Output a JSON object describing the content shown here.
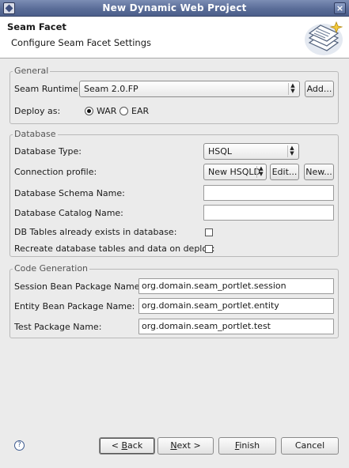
{
  "window": {
    "title": "New Dynamic Web Project"
  },
  "header": {
    "title": "Seam Facet",
    "description": "Configure Seam Facet Settings"
  },
  "general": {
    "label": "General",
    "runtime_label": "Seam Runtime:",
    "runtime_value": "Seam 2.0.FP",
    "add_label": "Add...",
    "deploy_label": "Deploy as:",
    "war_label": "WAR",
    "ear_label": "EAR",
    "deploy_selected": "WAR"
  },
  "database": {
    "label": "Database",
    "type_label": "Database Type:",
    "type_value": "HSQL",
    "profile_label": "Connection profile:",
    "profile_value": "New HSQLD",
    "edit_label": "Edit...",
    "new_label": "New...",
    "schema_label": "Database Schema Name:",
    "schema_value": "",
    "catalog_label": "Database Catalog Name:",
    "catalog_value": "",
    "tables_exist_label": "DB Tables already exists in database:",
    "tables_exist_checked": false,
    "recreate_label": "Recreate database tables and data on deploy:",
    "recreate_checked": false
  },
  "codegen": {
    "label": "Code Generation",
    "session_label": "Session Bean Package Name:",
    "session_value": "org.domain.seam_portlet.session",
    "entity_label": "Entity Bean Package Name:",
    "entity_value": "org.domain.seam_portlet.entity",
    "test_label": "Test Package Name:",
    "test_value": "org.domain.seam_portlet.test"
  },
  "footer": {
    "back_prefix": "< ",
    "back_mnemonic": "B",
    "back_rest": "ack",
    "next_prefix": "",
    "next_mnemonic": "N",
    "next_rest": "ext >",
    "finish_mnemonic": "F",
    "finish_rest": "inish",
    "cancel_label": "Cancel"
  },
  "icons": {
    "help": "help-icon",
    "banner": "seam-facet-banner-icon",
    "window": "window-icon",
    "close": "close-icon"
  }
}
